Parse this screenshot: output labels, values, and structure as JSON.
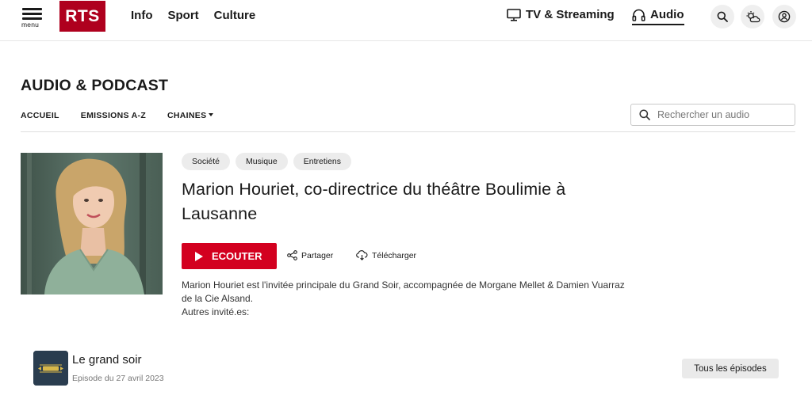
{
  "header": {
    "menu_label": "menu",
    "logo_text": "RTS",
    "nav": [
      "Info",
      "Sport",
      "Culture"
    ],
    "tv_label": "TV & Streaming",
    "audio_label": "Audio",
    "icons": [
      "search-icon",
      "weather-icon",
      "account-icon"
    ]
  },
  "section": {
    "title": "AUDIO & PODCAST",
    "subnav": {
      "home": "ACCUEIL",
      "shows": "EMISSIONS A-Z",
      "channels": "CHAINES"
    },
    "search_placeholder": "Rechercher un audio"
  },
  "episode": {
    "tags": [
      "Société",
      "Musique",
      "Entretiens"
    ],
    "title": "Marion Houriet, co-directrice du théâtre Boulimie à Lausanne",
    "listen_label": "ECOUTER",
    "share_label": "Partager",
    "download_label": "Télécharger",
    "description_line1": "Marion Houriet est l'invitée principale du Grand Soir, accompagnée de Morgane Mellet & Damien Vuarraz de la Cie Alsand.",
    "description_line2": "Autres invité.es:"
  },
  "show": {
    "name": "Le grand soir",
    "date": "Episode du 27 avril 2023",
    "all_episodes_label": "Tous les épisodes",
    "thumb_text": "Le grand soir"
  },
  "colors": {
    "brand_red": "#af001e",
    "button_red": "#d3001f",
    "chip_bg": "#ececec"
  }
}
